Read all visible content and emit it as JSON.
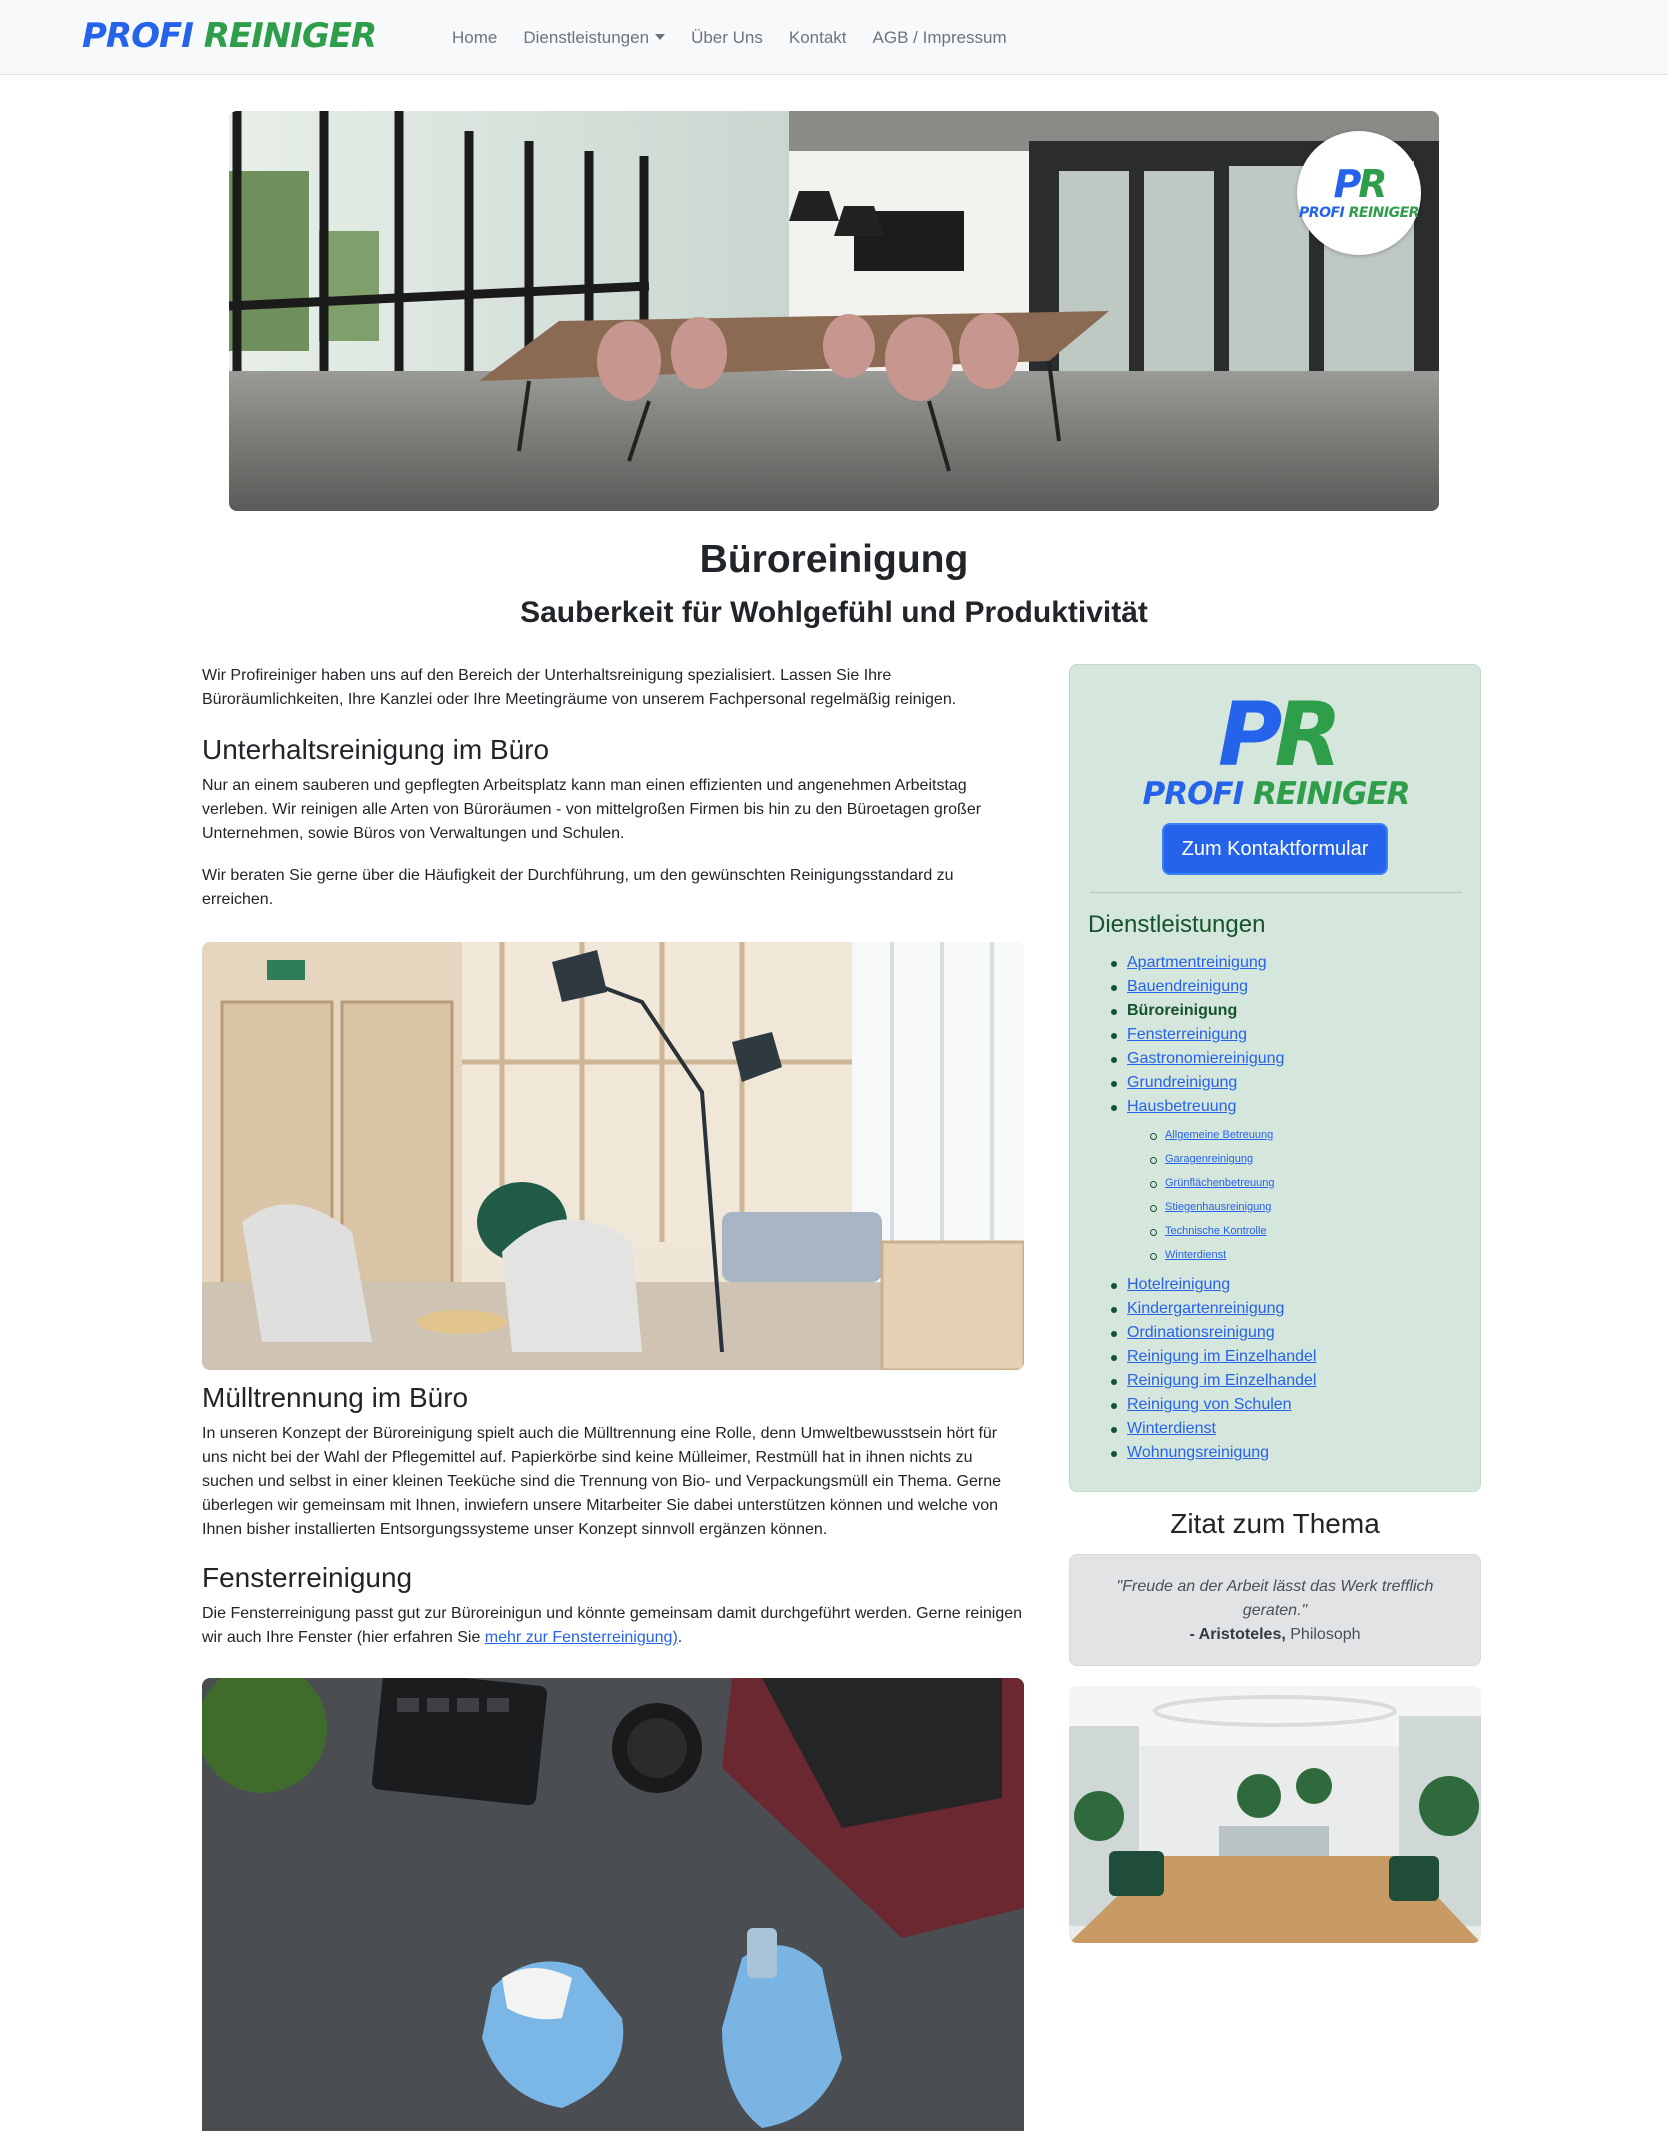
{
  "brand": {
    "part1": "PROFI",
    "part2": "REINIGER"
  },
  "nav": {
    "items": [
      {
        "label": "Home"
      },
      {
        "label": "Dienstleistungen",
        "dropdown": true
      },
      {
        "label": "Über Uns"
      },
      {
        "label": "Kontakt"
      },
      {
        "label": "AGB / Impressum"
      }
    ]
  },
  "hero": {
    "badge_monogram_p": "P",
    "badge_monogram_r": "R",
    "badge_text_1": "PROFI",
    "badge_text_2": "REINIGER"
  },
  "page": {
    "title": "Büroreinigung",
    "subtitle": "Sauberkeit für Wohlgefühl und Produktivität"
  },
  "main": {
    "intro": "Wir Profireiniger haben uns auf den Bereich der Unterhaltsreinigung spezialisiert. Lassen Sie Ihre Büroräumlichkeiten, Ihre Kanzlei oder Ihre Meetingräume von unserem Fachpersonal regelmäßig reinigen.",
    "section1_heading": "Unterhaltsreinigung im Büro",
    "section1_p1": "Nur an einem sauberen und gepflegten Arbeitsplatz kann man einen effizienten und angenehmen Arbeitstag verleben. Wir reinigen alle Arten von Büroräumen - von mittelgroßen Firmen bis hin zu den Büroetagen großer Unternehmen, sowie Büros von Verwaltungen und Schulen.",
    "section1_p2": "Wir beraten Sie gerne über die Häufigkeit der Durchführung, um den gewünschten Reinigungsstandard zu erreichen.",
    "section2_heading": "Mülltrennung im Büro",
    "section2_p": "In unseren Konzept der Büroreinigung spielt auch die Mülltrennung eine Rolle, denn Umweltbewusstsein hört für uns nicht bei der Wahl der Pflegemittel auf. Papierkörbe sind keine Mülleimer, Restmüll hat in ihnen nichts zu suchen und selbst in einer kleinen Teeküche sind die Trennung von Bio- und Verpackungsmüll ein Thema. Gerne überlegen wir gemeinsam mit Ihnen, inwiefern unsere Mitarbeiter Sie dabei unterstützen können und welche von Ihnen bisher installierten Entsorgungssysteme unser Konzept sinnvoll ergänzen können.",
    "section3_heading": "Fensterreinigung",
    "section3_p_before": "Die Fensterreinigung passt gut zur Büroreinigun und könnte gemeinsam damit durchgeführt werden. Gerne reinigen wir auch Ihre Fenster (hier erfahren Sie ",
    "section3_link": "mehr zur Fensterreinigung)",
    "section3_p_after": "."
  },
  "sidebar": {
    "logo_p": "P",
    "logo_r": "R",
    "logo_text_1": "PROFI",
    "logo_text_2": "REINIGER",
    "contact_button": "Zum Kontaktformular",
    "services_heading": "Dienstleistungen",
    "services": [
      "Apartmentreinigung",
      "Bauendreinigung",
      "Büroreinigung",
      "Fensterreinigung",
      "Gastronomiereinigung",
      "Grundreinigung",
      "Hausbetreuung"
    ],
    "active_service_index": 2,
    "sub_services": [
      "Allgemeine Betreuung",
      "Garagenreinigung",
      "Grünflächenbetreuung",
      "Stiegenhausreinigung",
      "Technische Kontrolle",
      "Winterdienst"
    ],
    "services_after": [
      "Hotelreinigung",
      "Kindergartenreinigung",
      "Ordinationsreinigung",
      "Reinigung im Einzelhandel",
      "Reinigung im Einzelhandel",
      "Reinigung von Schulen",
      "Winterdienst",
      "Wohnungsreinigung"
    ]
  },
  "quote": {
    "heading": "Zitat zum Thema",
    "text": "\"Freude an der Arbeit lässt das Werk trefflich geraten.\"",
    "author": "- Aristoteles,",
    "role": "Philosoph"
  },
  "colors": {
    "brand_blue": "#2563eb",
    "brand_green": "#2e9e4b",
    "sidebar_bg": "#d5e6dc",
    "quote_bg": "#e2e3e5"
  }
}
